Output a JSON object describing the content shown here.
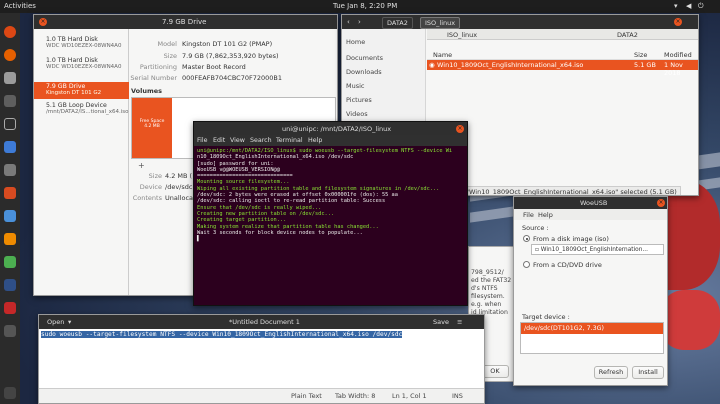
{
  "top_panel": {
    "activities": "Activities",
    "clock": "Tue Jan 8, 2:20 PM"
  },
  "disks": {
    "title": "7.9 GB Drive",
    "devices": [
      {
        "name": "1.0 TB Hard Disk",
        "sub": "WDC WD10EZEX-08WN4A0"
      },
      {
        "name": "1.0 TB Hard Disk",
        "sub": "WDC WD10EZEX-08WN4A0"
      },
      {
        "name": "7.9 GB Drive",
        "sub": "Kingston DT 101 G2"
      },
      {
        "name": "5.1 GB Loop Device",
        "sub": "/mnt/DATA2/IS...tional_x64.iso"
      }
    ],
    "model_label": "Model",
    "model_value": "Kingston DT 101 G2 (PMAP)",
    "size_label": "Size",
    "size_value": "7.9 GB (7,862,353,920 bytes)",
    "partitioning_label": "Partitioning",
    "partitioning_value": "Master Boot Record",
    "serial_label": "Serial Number",
    "serial_value": "000FEAFB704CBC70F72000B1",
    "volumes_label": "Volumes",
    "free_space_label": "Free Space\n4.2 MB",
    "part_label": "Windows USB\nPartition 1",
    "detail_size_label": "Size",
    "detail_size_value": "4.2 MB (",
    "detail_device_label": "Device",
    "detail_device_value": "/dev/sdc",
    "detail_contents_label": "Contents",
    "detail_contents_value": "Unallocat"
  },
  "files": {
    "tab": "DATA2",
    "crumb_active": "ISO_linux",
    "col_tab1": "ISO_linux",
    "col_tab2": "DATA2",
    "col_name": "Name",
    "col_size": "Size",
    "col_modified": "Modified",
    "file_name": "Win10_1809Oct_EnglishInternational_x64.iso",
    "file_size": "5.1 GB",
    "file_modified": "1 Nov 2018",
    "sidebar": [
      "Home",
      "Documents",
      "Downloads",
      "Music",
      "Pictures",
      "Videos"
    ],
    "status": "\"Win10_1809Oct_EnglishInternational_x64.iso\" selected (5.1 GB)"
  },
  "terminal": {
    "title": "uni@unipc: /mnt/DATA2/ISO_linux",
    "menu": [
      "File",
      "Edit",
      "View",
      "Search",
      "Terminal",
      "Help"
    ],
    "lines": [
      {
        "c": "tg",
        "t": "uni@unipc:/mnt/DATA2/ISO_linux$ sudo woeusb --target-filesystem NTFS --device Wi"
      },
      {
        "c": "tw",
        "t": "n10_1809Oct_EnglishInternational_x64.iso /dev/sdc"
      },
      {
        "c": "tw",
        "t": "[sudo] password for uni:"
      },
      {
        "c": "tw",
        "t": "WoeUSB v@@WOEUSB_VERSION@@"
      },
      {
        "c": "tw",
        "t": "=============================="
      },
      {
        "c": "tg",
        "t": "Mounting source filesystem..."
      },
      {
        "c": "tg",
        "t": "Wiping all existing partition table and filesystem signatures in /dev/sdc..."
      },
      {
        "c": "tw",
        "t": "/dev/sdc: 2 bytes were erased at offset 0x000001fe (dos): 55 aa"
      },
      {
        "c": "tw",
        "t": "/dev/sdc: calling ioctl to re-read partition table: Success"
      },
      {
        "c": "tg",
        "t": "Ensure that /dev/sdc is really wiped..."
      },
      {
        "c": "tg",
        "t": "Creating new partition table on /dev/sdc..."
      },
      {
        "c": "tg",
        "t": "Creating target partition..."
      },
      {
        "c": "tg",
        "t": "Making system realize that partition table has changed..."
      },
      {
        "c": "tw",
        "t": "Wait 3 seconds for block device nodes to populate..."
      },
      {
        "c": "tw",
        "t": "▌"
      }
    ]
  },
  "behind_text": [
    "798_9512/",
    "ed the FAT32",
    "d's NTFS",
    "filesystem.",
    "e.g. when",
    "id limitation"
  ],
  "behind_ok": "OK",
  "gedit": {
    "open_label": "Open",
    "title": "*Untitled Document 1",
    "save_label": "Save",
    "content": "sudo woeusb --target-filesystem NTFS --device Win10_1809Oct_EnglishInternational_x64.iso /dev/sdc",
    "status_lang": "Plain Text",
    "status_tab": "Tab Width: 8",
    "status_pos": "Ln 1, Col 1",
    "status_ins": "INS"
  },
  "woeusb": {
    "title": "WoeUSB",
    "menu": [
      "File",
      "Help"
    ],
    "source_label": "Source :",
    "from_image": "From a disk image (iso)",
    "file_field": "Win10_1809Oct_EnglishInternation...",
    "from_dvd": "From a CD/DVD drive",
    "target_label": "Target device :",
    "target_item": "/dev/sdc(DT101G2, 7.3G)",
    "refresh_label": "Refresh",
    "install_label": "Install"
  }
}
